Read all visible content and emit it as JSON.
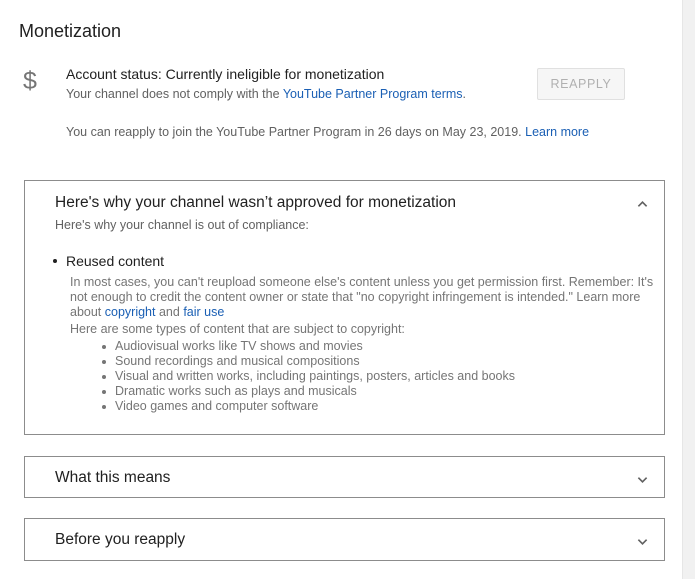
{
  "page": {
    "title": "Monetization"
  },
  "account": {
    "icon": "dollar-icon",
    "status_text": "Account status: Currently ineligible for monetization",
    "compliance_prefix": "Your channel does not comply with the",
    "terms_link": "YouTube Partner Program terms",
    "compliance_suffix": ".",
    "reapply_button": "REAPPLY",
    "reapply_info": "You can reapply to join the YouTube Partner Program in 26 days on May 23, 2019.",
    "learn_more": "Learn more"
  },
  "panels": [
    {
      "title": "Here's why your channel wasn’t approved for monetization",
      "expanded": true,
      "subtitle": "Here's why your channel is out of compliance:",
      "reason": {
        "title": "Reused content",
        "description_part1": "In most cases, you can't reupload someone else's content unless you get permission first. Remember: It's not enough to credit the content owner or state that \"no copyright infringement is intended.\" Learn more about",
        "copyright_link": "copyright",
        "and_text": "and",
        "fair_use_link": "fair use",
        "types_intro": "Here are some types of content that are subject to copyright:",
        "types": [
          "Audiovisual works like TV shows and movies",
          "Sound recordings and musical compositions",
          "Visual and written works, including paintings, posters, articles and books",
          "Dramatic works such as plays and musicals",
          "Video games and computer software"
        ]
      }
    },
    {
      "title": "What this means",
      "expanded": false
    },
    {
      "title": "Before you reapply",
      "expanded": false
    }
  ],
  "colors": {
    "link": "#1a5fb4",
    "text_primary": "#212121",
    "text_secondary": "#616161",
    "panel_border": "#8c8c8c"
  }
}
